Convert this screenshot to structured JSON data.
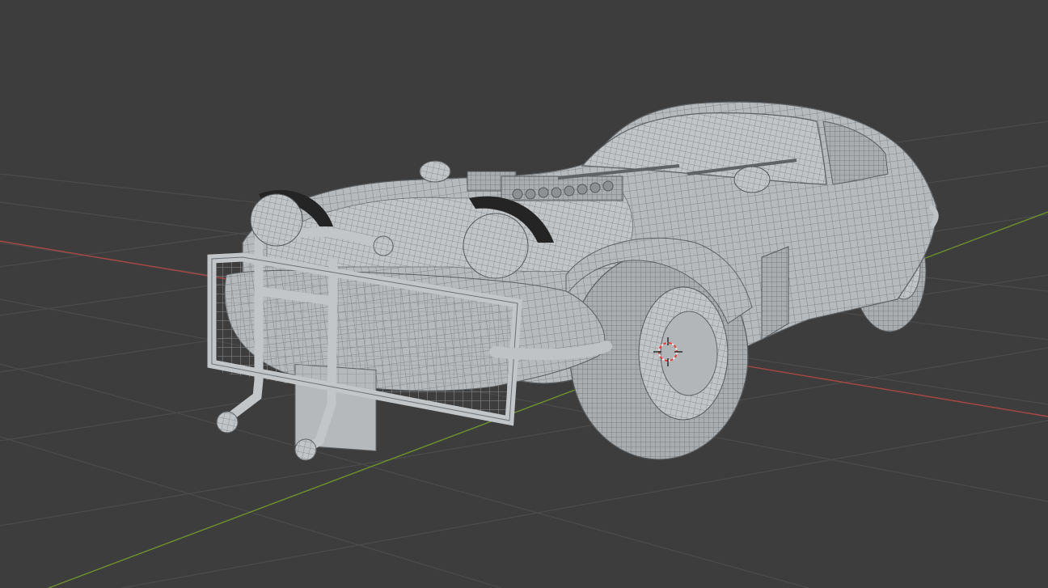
{
  "viewport": {
    "background": "#3d3d3d",
    "grid_color": "#4a4a4a",
    "x_axis_color": "#b44a4a",
    "y_axis_color": "#7a9a32",
    "model_fill": "#b9bcbe",
    "wire_color": "#6e7276"
  },
  "scene_objects": [
    "car-model",
    "3d-cursor",
    "grid-floor",
    "x-axis-line",
    "y-axis-line"
  ]
}
